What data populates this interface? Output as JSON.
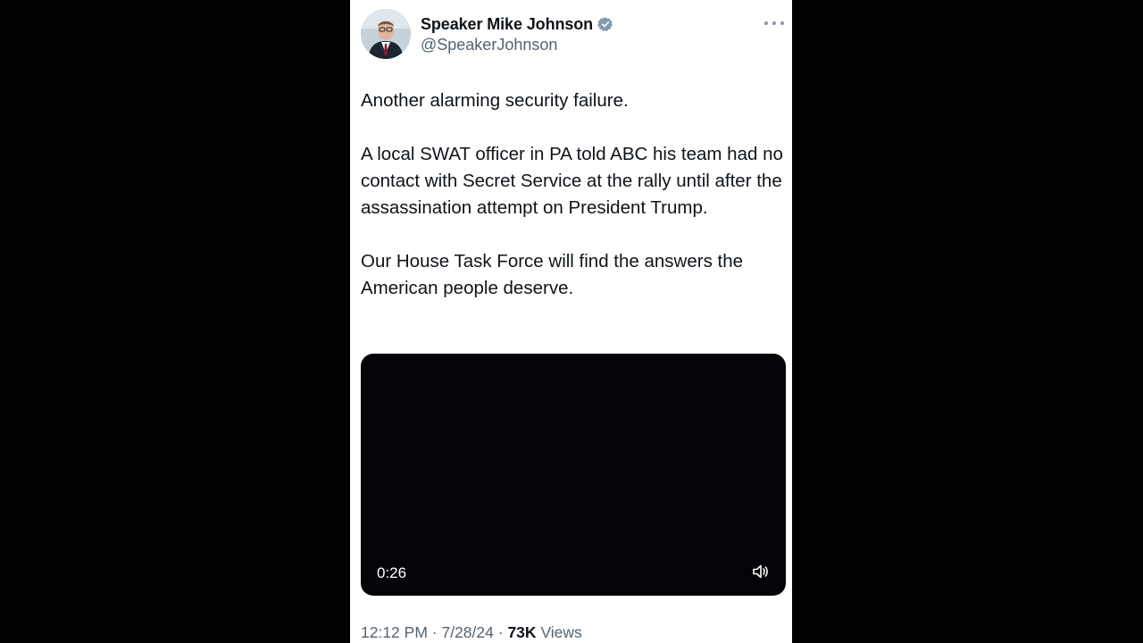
{
  "author": {
    "display_name": "Speaker Mike Johnson",
    "handle": "@SpeakerJohnson",
    "verified_badge_color": "#829aab"
  },
  "tweet": {
    "paragraphs": [
      "Another alarming security failure.",
      "A local SWAT officer in PA told ABC his team had no contact with Secret Service at the rally until after the assassination attempt on President Trump.",
      "Our House Task Force will find the answers the American people deserve."
    ]
  },
  "video": {
    "duration": "0:26",
    "icon": "volume-icon"
  },
  "meta": {
    "time": "12:12 PM",
    "separator": "·",
    "date": "7/28/24",
    "views_count": "73K",
    "views_label": "Views"
  },
  "icons": {
    "more": "more-horizontal-icon",
    "verified": "verified-badge-icon"
  },
  "colors": {
    "background": "#000000",
    "card": "#ffffff",
    "text_primary": "#0f1419",
    "text_secondary": "#536471",
    "video_bg": "#050307"
  }
}
